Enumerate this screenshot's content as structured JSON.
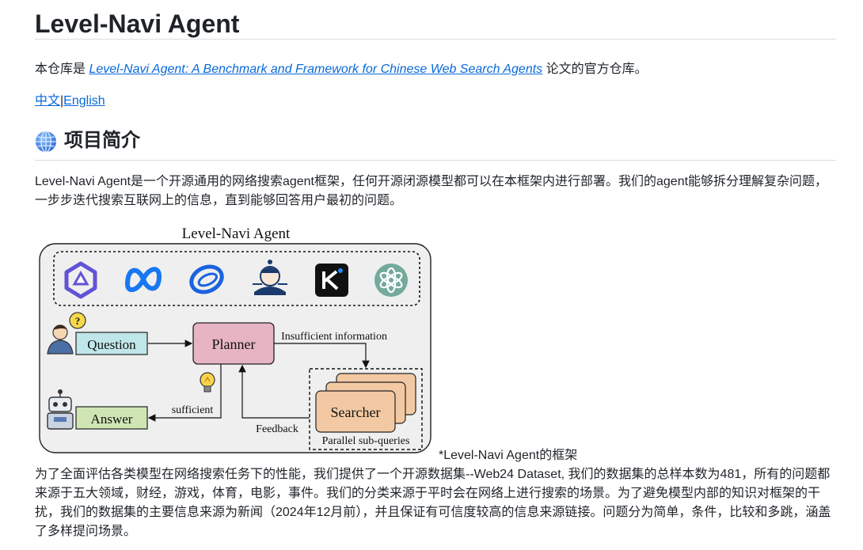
{
  "title": "Level-Navi Agent",
  "repo_intro": {
    "prefix": "本仓库是 ",
    "paper_link": "Level-Navi Agent: A Benchmark and Framework for Chinese Web Search Agents",
    "suffix": " 论文的官方仓库。"
  },
  "languages": {
    "zh": "中文",
    "separator": "|",
    "en": "English"
  },
  "section_heading": "项目简介",
  "intro_paragraph": "Level-Navi Agent是一个开源通用的网络搜索agent框架，任何开源闭源模型都可以在本框架内进行部署。我们的agent能够拆分理解复杂问题，一步步迭代搜索互联网上的信息，直到能够回答用户最初的问题。",
  "figure": {
    "title": "Level-Navi Agent",
    "question": "Question",
    "planner": "Planner",
    "insufficient": "Insufficient information",
    "searcher": "Searcher",
    "parallel": "Parallel sub-queries",
    "feedback": "Feedback",
    "sufficient": "sufficient",
    "answer": "Answer",
    "caption": "*Level-Navi Agent的框架",
    "logos": [
      "qwen-logo",
      "meta-logo",
      "zhipu-logo",
      "internlm-logo",
      "kimi-logo",
      "openai-logo"
    ]
  },
  "dataset_paragraph": "为了全面评估各类模型在网络搜索任务下的性能，我们提供了一个开源数据集--Web24 Dataset, 我们的数据集的总样本数为481，所有的问题都来源于五大领域，财经，游戏，体育，电影，事件。我们的分类来源于平时会在网络上进行搜索的场景。为了避免模型内部的知识对框架的干扰，我们的数据集的主要信息来源为新闻（2024年12月前），并且保证有可信度较高的信息来源链接。问题分为简单，条件，比较和多跳，涵盖了多样提问场景。"
}
